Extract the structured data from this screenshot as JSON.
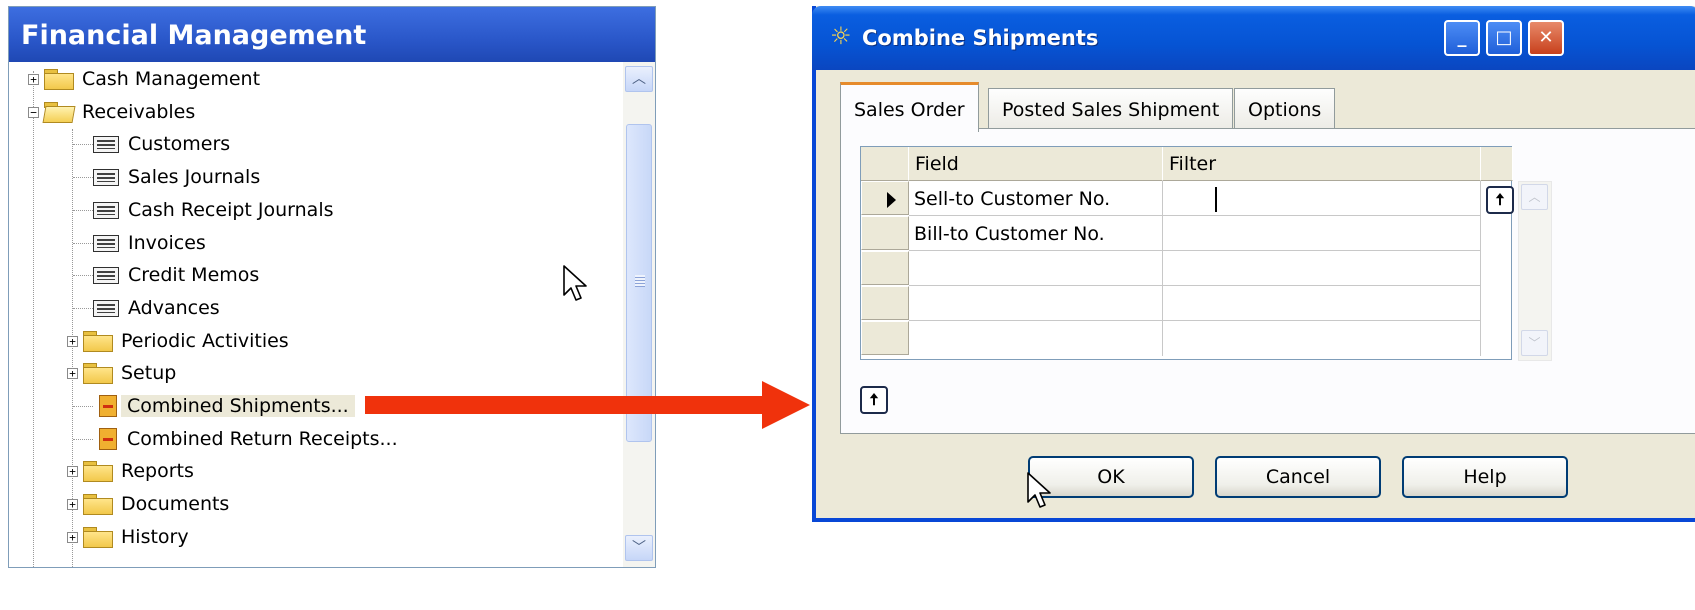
{
  "nav": {
    "title": "Financial Management",
    "items": [
      {
        "label": "Cash Management",
        "expander": "+"
      },
      {
        "label": "Receivables",
        "expander": "−"
      },
      {
        "label": "Customers"
      },
      {
        "label": "Sales Journals"
      },
      {
        "label": "Cash Receipt Journals"
      },
      {
        "label": "Invoices"
      },
      {
        "label": "Credit Memos"
      },
      {
        "label": "Advances"
      },
      {
        "label": "Periodic Activities",
        "expander": "+"
      },
      {
        "label": "Setup",
        "expander": "+"
      },
      {
        "label": "Combined Shipments..."
      },
      {
        "label": "Combined Return Receipts..."
      },
      {
        "label": "Reports",
        "expander": "+"
      },
      {
        "label": "Documents",
        "expander": "+"
      },
      {
        "label": "History",
        "expander": "+"
      }
    ],
    "scroll_up_glyph": "︿",
    "scroll_down_glyph": "﹀"
  },
  "dialog": {
    "title": "Combine Shipments",
    "title_icon": "☼",
    "minimize_glyph": "_",
    "maximize_glyph": "□",
    "close_glyph": "✕",
    "tabs": [
      "Sales Order",
      "Posted Sales Shipment",
      "Options"
    ],
    "active_tab": "Sales Order",
    "grid": {
      "columns": [
        "Field",
        "Filter"
      ],
      "rows": [
        {
          "field": "Sell-to Customer No.",
          "filter": ""
        },
        {
          "field": "Bill-to Customer No.",
          "filter": ""
        },
        {
          "field": "",
          "filter": ""
        },
        {
          "field": "",
          "filter": ""
        },
        {
          "field": "",
          "filter": ""
        }
      ]
    },
    "up_glyph": "🠅",
    "buttons": {
      "ok": "OK",
      "cancel": "Cancel",
      "help": "Help"
    }
  },
  "colors": {
    "nav_title_bg": "#2a57c9",
    "dialog_titlebar": "#0654d4",
    "arrow": "#f0320c",
    "active_tab_accent": "#e68b2c"
  }
}
